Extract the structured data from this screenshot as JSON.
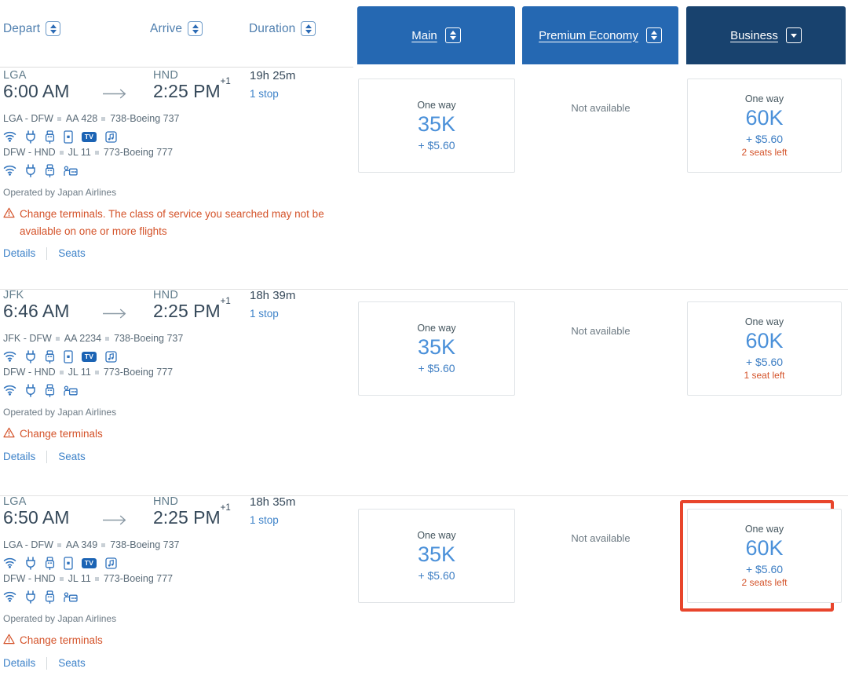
{
  "header": {
    "sort_columns": [
      {
        "label": "Depart",
        "icon": "sort-updown-icon"
      },
      {
        "label": "Arrive",
        "icon": "sort-updown-icon"
      },
      {
        "label": "Duration",
        "icon": "sort-updown-icon"
      }
    ],
    "cabin_tabs": [
      {
        "label": "Main",
        "icon": "sort-updown-icon",
        "color": "#2568b2",
        "selected": false
      },
      {
        "label": "Premium Economy",
        "icon": "sort-updown-icon",
        "color": "#2568b2",
        "selected": false
      },
      {
        "label": "Business",
        "icon": "chevron-down-icon",
        "color": "#18426e",
        "selected": true
      }
    ]
  },
  "colors": {
    "accent_blue": "#2568b2",
    "selected_tab": "#18426e",
    "link_blue": "#3f83c9",
    "points_blue": "#4a90d9",
    "warning_orange": "#d4532a",
    "highlight_red": "#e8452c"
  },
  "labels": {
    "details": "Details",
    "seats": "Seats",
    "one_way": "One way",
    "not_available": "Not available",
    "tv_badge": "TV"
  },
  "flights": [
    {
      "depart_airport": "LGA",
      "depart_time": "6:00 AM",
      "arrive_airport": "HND",
      "arrive_time": "2:25 PM",
      "arrive_day_offset": "+1",
      "duration": "19h 25m",
      "stops": "1 stop",
      "legs": [
        {
          "route": "LGA - DFW",
          "flight_number": "AA 428",
          "aircraft": "738-Boeing 737",
          "amenities": [
            "wifi-icon",
            "power-outlet-icon",
            "usb-icon",
            "device-icon",
            "tv-icon",
            "music-icon"
          ]
        },
        {
          "route": "DFW - HND",
          "flight_number": "JL 11",
          "aircraft": "773-Boeing 777",
          "amenities": [
            "wifi-icon",
            "power-outlet-icon",
            "usb-icon",
            "lie-flat-seat-icon"
          ]
        }
      ],
      "operated_by": "Operated by Japan Airlines",
      "warning": "Change terminals. The class of service you searched may not be available on one or more flights",
      "fares": {
        "main": {
          "available": true,
          "one_way": "One way",
          "points": "35K",
          "tax": "+ $5.60",
          "seats_left": null
        },
        "premium_economy": {
          "available": false,
          "text": "Not available"
        },
        "business": {
          "available": true,
          "one_way": "One way",
          "points": "60K",
          "tax": "+ $5.60",
          "seats_left": "2 seats left",
          "highlighted": false
        }
      }
    },
    {
      "depart_airport": "JFK",
      "depart_time": "6:46 AM",
      "arrive_airport": "HND",
      "arrive_time": "2:25 PM",
      "arrive_day_offset": "+1",
      "duration": "18h 39m",
      "stops": "1 stop",
      "legs": [
        {
          "route": "JFK - DFW",
          "flight_number": "AA 2234",
          "aircraft": "738-Boeing 737",
          "amenities": [
            "wifi-icon",
            "power-outlet-icon",
            "usb-icon",
            "device-icon",
            "tv-icon",
            "music-icon"
          ]
        },
        {
          "route": "DFW - HND",
          "flight_number": "JL 11",
          "aircraft": "773-Boeing 777",
          "amenities": [
            "wifi-icon",
            "power-outlet-icon",
            "usb-icon",
            "lie-flat-seat-icon"
          ]
        }
      ],
      "operated_by": "Operated by Japan Airlines",
      "warning": "Change terminals",
      "fares": {
        "main": {
          "available": true,
          "one_way": "One way",
          "points": "35K",
          "tax": "+ $5.60",
          "seats_left": null
        },
        "premium_economy": {
          "available": false,
          "text": "Not available"
        },
        "business": {
          "available": true,
          "one_way": "One way",
          "points": "60K",
          "tax": "+ $5.60",
          "seats_left": "1 seat left",
          "highlighted": false
        }
      }
    },
    {
      "depart_airport": "LGA",
      "depart_time": "6:50 AM",
      "arrive_airport": "HND",
      "arrive_time": "2:25 PM",
      "arrive_day_offset": "+1",
      "duration": "18h 35m",
      "stops": "1 stop",
      "legs": [
        {
          "route": "LGA - DFW",
          "flight_number": "AA 349",
          "aircraft": "738-Boeing 737",
          "amenities": [
            "wifi-icon",
            "power-outlet-icon",
            "usb-icon",
            "device-icon",
            "tv-icon",
            "music-icon"
          ]
        },
        {
          "route": "DFW - HND",
          "flight_number": "JL 11",
          "aircraft": "773-Boeing 777",
          "amenities": [
            "wifi-icon",
            "power-outlet-icon",
            "usb-icon",
            "lie-flat-seat-icon"
          ]
        }
      ],
      "operated_by": "Operated by Japan Airlines",
      "warning": "Change terminals",
      "fares": {
        "main": {
          "available": true,
          "one_way": "One way",
          "points": "35K",
          "tax": "+ $5.60",
          "seats_left": null
        },
        "premium_economy": {
          "available": false,
          "text": "Not available"
        },
        "business": {
          "available": true,
          "one_way": "One way",
          "points": "60K",
          "tax": "+ $5.60",
          "seats_left": "2 seats left",
          "highlighted": true
        }
      }
    }
  ]
}
